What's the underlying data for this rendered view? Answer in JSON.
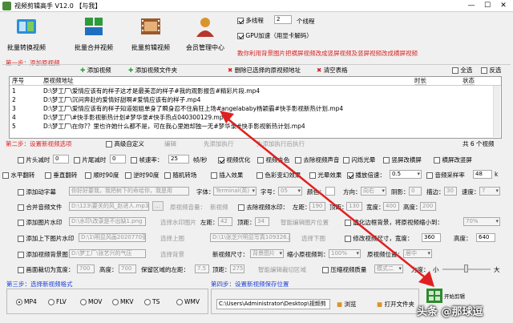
{
  "window": {
    "title": "视频剪辑高手 V12.0 【与我】",
    "min": "—",
    "max": "☐",
    "close": "✕"
  },
  "toolbar": {
    "items": [
      {
        "label": "批量转换视频"
      },
      {
        "label": "批量合并视频"
      },
      {
        "label": "批量剪辑视频"
      },
      {
        "label": "会员管理中心"
      }
    ],
    "multithread_label": "多线程",
    "multithread_value": "2",
    "multithread_unit": "个线程",
    "gpu_label": "GPU加速（用显卡解码）",
    "ad_text": "教你利用背景图片把横屏视频改成竖屏视频及竖屏视频改成横屏视频"
  },
  "step1": {
    "title": "第一步：添加原视频",
    "add_video": "添加视频",
    "add_folder": "添加视频文件夹",
    "delete_selected": "删除已选择的原视频地址",
    "clear_table": "清空表格",
    "select_all": "全选",
    "invert": "反选"
  },
  "table": {
    "headers": {
      "no": "序号",
      "path": "原视频地址",
      "duration": "时长",
      "status": "状态"
    },
    "rows": [
      {
        "no": "1",
        "path": "D:\\梦工厂\\爱情应该有的样子这才是最美恋的样子#我的观影报告#精彩片段.mp4"
      },
      {
        "no": "2",
        "path": "D:\\梦工厂\\沉问奔赴的爱情好甜啊#爱情应该有的样子.mp4"
      },
      {
        "no": "3",
        "path": "D:\\梦工厂\\爱情应该有的样子知道姐姐单身了瞬身忍不住肩狂上场#angelababy杨颖霸#快手影视新热计划.mp4"
      },
      {
        "no": "4",
        "path": "D:\\梦工厂\\#快手影视新热计划#梦华录#快手热点040300129.mp4"
      },
      {
        "no": "5",
        "path": "D:\\梦工厂\\在你?？里也许她什么都不是，可在我心里她却独一无#梦华录#快手影视新热计划.mp4"
      }
    ]
  },
  "step2": {
    "title": "第二步：设置新视频选项",
    "advanced": "高级自定义",
    "edit": "编辑",
    "exec_first": "先添加执行",
    "exec_after": "先添加执行后执行",
    "count": "共 6 个视频",
    "r1": {
      "head": "片头减时",
      "head_v": "0",
      "tail": "片尾减时",
      "tail_v": "0",
      "fps": "帧速率：",
      "fps_v": "25",
      "fps_unit": "帧/秒",
      "opt": "视频优化",
      "color": "视频去色",
      "remove_audio": "去除视频声音",
      "flash": "闪烁光晕",
      "vert_blur": "竖屏改横屏",
      "horz_blur": "横屏改竖屏"
    },
    "r2": {
      "hflip": "水平翻转",
      "vflip": "垂直翻转",
      "cw90": "顺时90度",
      "ccw90": "逆时90度",
      "rand_transition": "随机转场",
      "insert_effect": "插入效果",
      "color_diff": "色彩变幻效果",
      "light": "光晕效果",
      "speed_label": "播放倍速：",
      "speed_v": "0.5",
      "samplerate": "音频采样率",
      "samplerate_v": "48"
    },
    "r3": {
      "text_wm": "添加动字幕",
      "text_ph": "你好好要我，我把树下的命给你，我是用",
      "font": "字体：",
      "font_v": "Terminal(英)",
      "size": "字号：",
      "size_v": "05",
      "color": "颜色：",
      "direction": "方向：",
      "direction_v": "向右",
      "shadow": "阴影：",
      "shadow_v": "0",
      "border": "描边：",
      "border_v": "30",
      "speed": "速度：",
      "speed_v": "7"
    },
    "r4": {
      "merge_audio": "合并音频文件",
      "audio_path": "D:\\123\\要关的风_赵进人.mp3",
      "orig_audio": "原视频音量：",
      "new_video": "新视频",
      "remove_watermark": "去除视频水印：",
      "left": "左距：",
      "left_v": "190",
      "top": "顶距：",
      "top_v": "130",
      "width": "宽度：",
      "width_v": "400",
      "height": "高度：",
      "height_v": "200"
    },
    "r5": {
      "img_wm": "添加图片水印",
      "img_path": "D:\\水印\\改录是不出缺1.png",
      "img_pos": "选择水印图片",
      "left": "左距：",
      "left_v": "42",
      "top": "顶距：",
      "top_v": "34",
      "smart_pos": "智能编辑图片位置",
      "virtual_bg": "虚化边框背景，将原视频缩小到：",
      "shrink_v": "70%"
    },
    "r6": {
      "top_bottom": "添加上下图片水印",
      "top_img": "D:\\1\\明显风画2020770张芝兴103",
      "top_sel": "选择上图",
      "bottom_img": "D:\\1\\张芝兴明显写真109326.jp",
      "bottom_sel": "选择下图",
      "resize": "修改视频尺寸，宽度：",
      "resize_w": "360",
      "resize_h_label": "高度：",
      "resize_h": "640"
    },
    "r7": {
      "bg_img": "添加视频背景图",
      "bg_path": "D:\\梦工厂\\张艺兴的气压",
      "bg_sel": "选择背景",
      "bg_set": "新视频尺寸：",
      "bg_set_v": "背景图片",
      "shrink": "缩小原视频到：",
      "shrink_v": "100%",
      "orig_pos": "原视频位置：",
      "orig_pos_v": "居中"
    },
    "r8": {
      "crop": "画面裁切为宽度：",
      "crop_w": "700",
      "crop_h_label": "高度：",
      "crop_h": "700",
      "keep": "保留区域的左距：",
      "keep_v": "7.5",
      "top": "顶距：",
      "top_v": "275",
      "smart_crop": "智能编辑裁切区域",
      "compress": "压缩视频质量",
      "mode": "模式二",
      "strength": "力度：",
      "small": "小",
      "large": "大"
    }
  },
  "step3": {
    "title": "第三步：选择新视频格式",
    "formats": [
      "MP4",
      "FLV",
      "MOV",
      "MKV",
      "TS",
      "WMV"
    ],
    "selected": "MP4"
  },
  "step4": {
    "title": "第四步：设置新视频保存位置",
    "path": "C:\\Users\\Administrator\\Desktop\\视频剪",
    "browse": "浏览",
    "open": "打开文件夹",
    "start": "开始剪辑"
  },
  "watermark": {
    "text": "头条 @那球逗"
  }
}
